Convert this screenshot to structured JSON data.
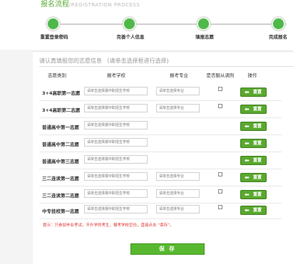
{
  "header": {
    "title": "报名流程",
    "title_en": "/REGISTRATION PROCESS"
  },
  "steps": [
    {
      "label": "重置登录密码"
    },
    {
      "label": "完善个人信息"
    },
    {
      "label": "填报志愿"
    },
    {
      "label": "完成报名"
    }
  ],
  "form": {
    "instruction": "请认真填报您的志愿信息 （请单击选择框进行选择)",
    "columns": [
      "志愿类别",
      "报考学校",
      "报考专业",
      "是否服从调剂",
      "操作"
    ],
    "school_placeholder": "请单击选择报中职招生学校",
    "major_placeholder": "请单击选择专业",
    "reset_label": "重置",
    "rows": [
      {
        "category": "3+4高职第一志愿"
      },
      {
        "category": "3+4高职第二志愿"
      },
      {
        "category": "普通高中第一志愿"
      },
      {
        "category": "普通高中第二志愿"
      },
      {
        "category": "普通高中第三志愿"
      },
      {
        "category": "三二连读第一志愿"
      },
      {
        "category": "三二连读第二志愿"
      },
      {
        "category": "中专技校第一志愿"
      }
    ],
    "note": "提示：只参加毕业考试，不升学的考生，报考学校空白，直接点击 “保存”。",
    "save_label": "保 存"
  },
  "colors": {
    "accent": "#4fb84a",
    "button": "#5aa82f",
    "note": "#e12f2f"
  }
}
